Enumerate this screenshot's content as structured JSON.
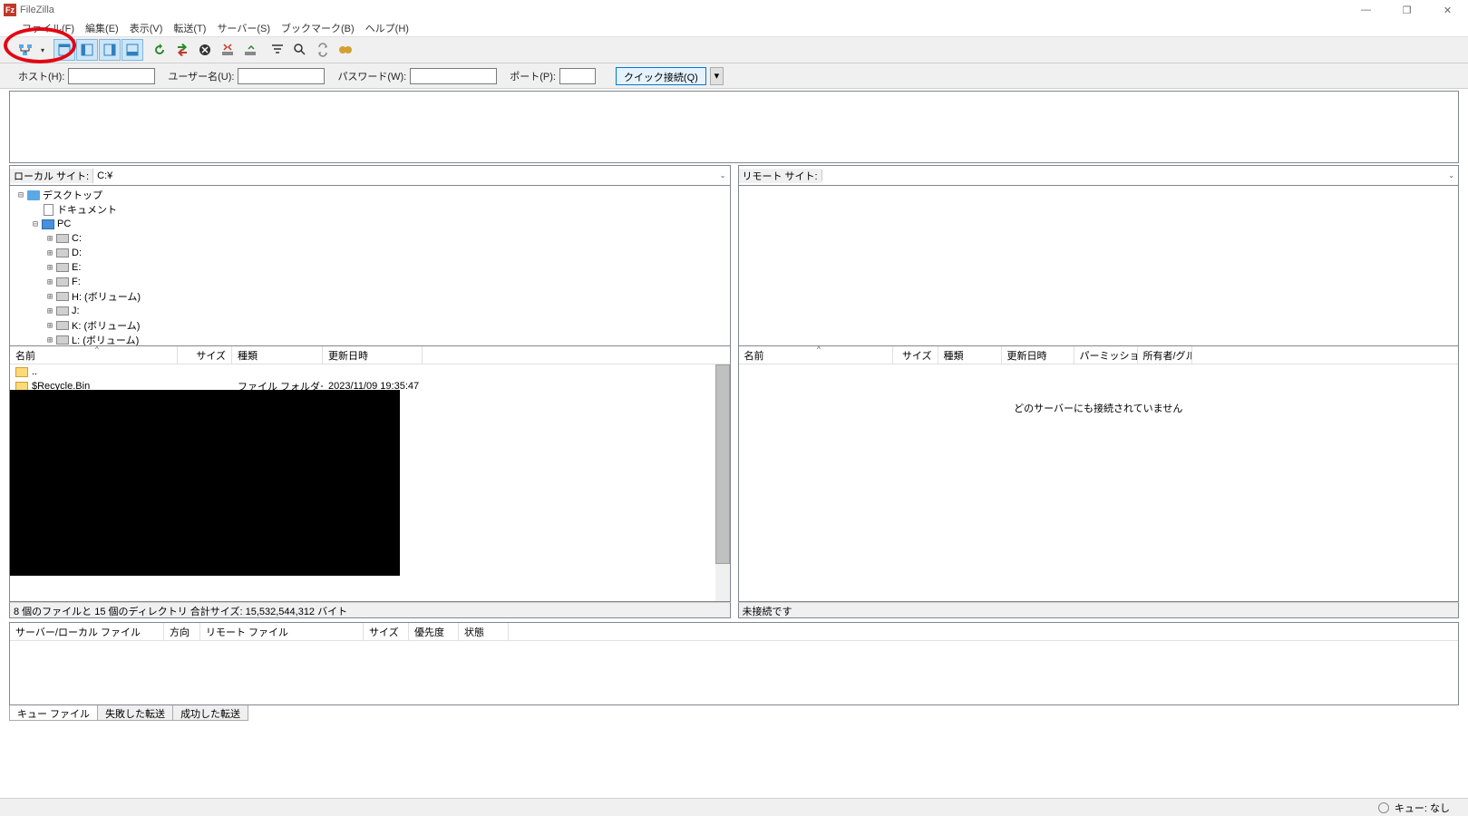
{
  "title": "FileZilla",
  "menu": [
    "ファイル(F)",
    "編集(E)",
    "表示(V)",
    "転送(T)",
    "サーバー(S)",
    "ブックマーク(B)",
    "ヘルプ(H)"
  ],
  "quick": {
    "host_label": "ホスト(H):",
    "user_label": "ユーザー名(U):",
    "pass_label": "パスワード(W):",
    "port_label": "ポート(P):",
    "connect": "クイック接続(Q)"
  },
  "local": {
    "label": "ローカル サイト:",
    "path": "C:¥",
    "tree": [
      {
        "indent": 0,
        "exp": "−",
        "icon": "folder",
        "label": "デスクトップ"
      },
      {
        "indent": 1,
        "exp": "",
        "icon": "doc",
        "label": "ドキュメント"
      },
      {
        "indent": 1,
        "exp": "−",
        "icon": "pc",
        "label": "PC"
      },
      {
        "indent": 2,
        "exp": "+",
        "icon": "drive",
        "label": "C:"
      },
      {
        "indent": 2,
        "exp": "+",
        "icon": "drive",
        "label": "D:"
      },
      {
        "indent": 2,
        "exp": "+",
        "icon": "drive",
        "label": "E:"
      },
      {
        "indent": 2,
        "exp": "+",
        "icon": "drive",
        "label": "F:"
      },
      {
        "indent": 2,
        "exp": "+",
        "icon": "drive",
        "label": "H: (ボリューム)"
      },
      {
        "indent": 2,
        "exp": "+",
        "icon": "drive",
        "label": "J:"
      },
      {
        "indent": 2,
        "exp": "+",
        "icon": "drive",
        "label": "K: (ボリューム)"
      },
      {
        "indent": 2,
        "exp": "+",
        "icon": "drive",
        "label": "L: (ボリューム)"
      }
    ],
    "cols": {
      "name": "名前",
      "size": "サイズ",
      "type": "種類",
      "date": "更新日時"
    },
    "widths": {
      "name": 185,
      "size": 60,
      "type": 100,
      "date": 110
    },
    "rows": [
      {
        "name": "..",
        "size": "",
        "type": "",
        "date": ""
      },
      {
        "name": "$Recycle.Bin",
        "size": "",
        "type": "ファイル フォルダー",
        "date": "2023/11/09 19:35:47"
      }
    ],
    "summary": "8 個のファイルと 15 個のディレクトリ 合計サイズ: 15,532,544,312 バイト"
  },
  "remote": {
    "label": "リモート サイト:",
    "path": "",
    "cols": {
      "name": "名前",
      "size": "サイズ",
      "type": "種類",
      "date": "更新日時",
      "perm": "パーミッション",
      "owner": "所有者/グル..."
    },
    "widths": {
      "name": 170,
      "size": 50,
      "type": 70,
      "date": 80,
      "perm": 70,
      "owner": 60
    },
    "empty": "どのサーバーにも接続されていません",
    "summary": "未接続です"
  },
  "queue": {
    "cols": [
      "サーバー/ローカル ファイル",
      "方向",
      "リモート ファイル",
      "サイズ",
      "優先度",
      "状態"
    ],
    "widths": [
      170,
      40,
      180,
      50,
      55,
      55
    ]
  },
  "tabs": [
    "キュー ファイル",
    "失敗した転送",
    "成功した転送"
  ],
  "statusbar": "キュー: なし"
}
